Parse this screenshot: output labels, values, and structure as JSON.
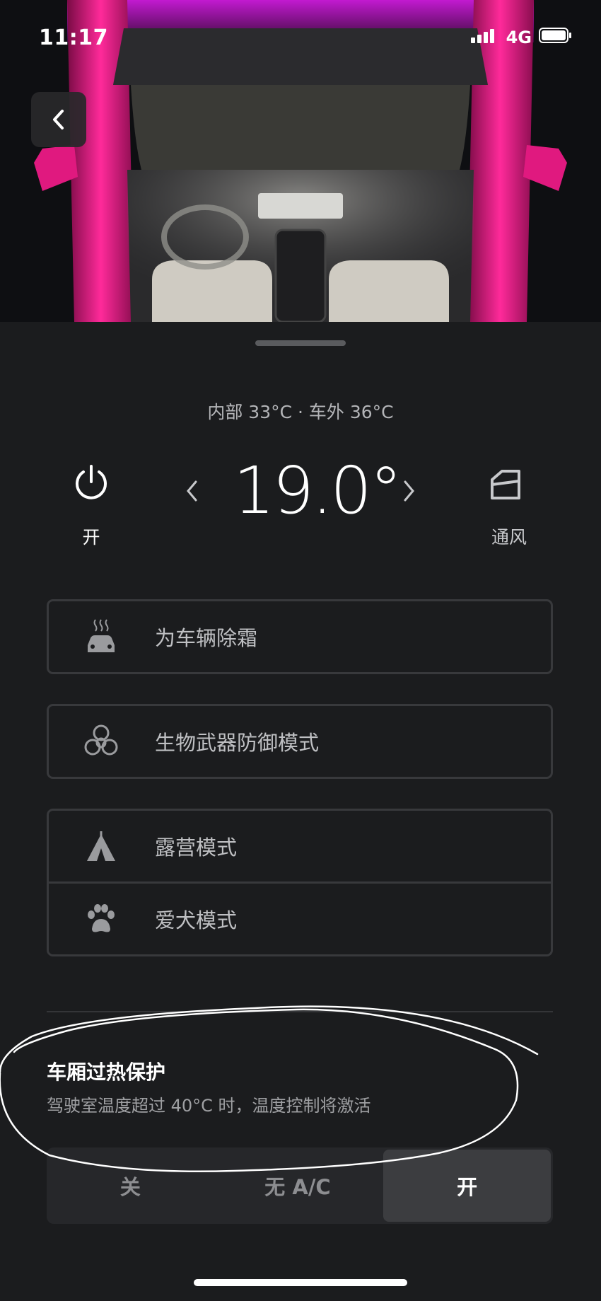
{
  "status_bar": {
    "time": "11:17",
    "network": "4G"
  },
  "climate": {
    "inside_outside": "内部 33°C · 车外 36°C",
    "setpoint": "19.0°",
    "power_label": "开",
    "vent_label": "通风"
  },
  "options": {
    "defrost": "为车辆除霜",
    "bioweapon": "生物武器防御模式",
    "camp": "露营模式",
    "dog": "爱犬模式"
  },
  "overheat": {
    "title": "车厢过热保护",
    "description": "驾驶室温度超过 40°C 时，温度控制将激活",
    "segments": [
      "关",
      "无 A/C",
      "开"
    ],
    "selected": "开"
  },
  "colors": {
    "accent_car": "#e0197f",
    "background": "#1b1c1e"
  }
}
